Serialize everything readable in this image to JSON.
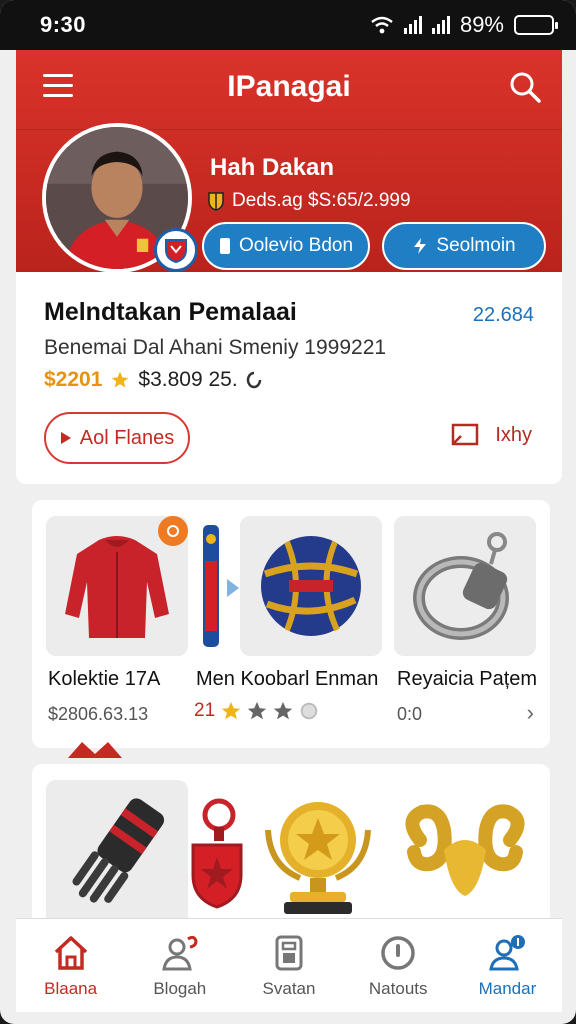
{
  "status_bar": {
    "time": "9:30",
    "battery": "89%",
    "battery_level": 0.89
  },
  "header": {
    "title": "IPanagai",
    "menu_icon": "hamburger-menu-icon",
    "search_icon": "search-icon"
  },
  "profile": {
    "name": "Hah Dakan",
    "meta": "Deds.ag $S:65/2.999",
    "button_primary": "Oolevio Bdon",
    "button_secondary": "Seolmoin"
  },
  "info": {
    "title": "Melndtakan Pemalaai",
    "count": "22.684",
    "subtitle": "Benemai Dal Ahani Smeniy 1999221",
    "price_orange": "$2201",
    "price_rest": "$3.809 25.",
    "add_button": "Aol Flanes",
    "save_label": "Ixhy"
  },
  "products": [
    {
      "name": "Kolektie 17A",
      "price": "$2806.63.13"
    },
    {
      "name": "Men Koobarl Enman",
      "rating_value": "21",
      "stars_filled": 3,
      "stars_total": 4
    },
    {
      "name": "Reyaicia Pațem",
      "price": "0:0"
    }
  ],
  "nav": [
    {
      "label": "Blaana",
      "icon": "home-icon"
    },
    {
      "label": "Blogah",
      "icon": "user-chat-icon"
    },
    {
      "label": "Svatan",
      "icon": "document-icon"
    },
    {
      "label": "Natouts",
      "icon": "info-circle-icon"
    },
    {
      "label": "Mandar",
      "icon": "user-add-icon"
    }
  ],
  "colors": {
    "brand_red": "#c72a22",
    "accent_blue": "#1f7ec4",
    "star_gold": "#f0b419"
  }
}
